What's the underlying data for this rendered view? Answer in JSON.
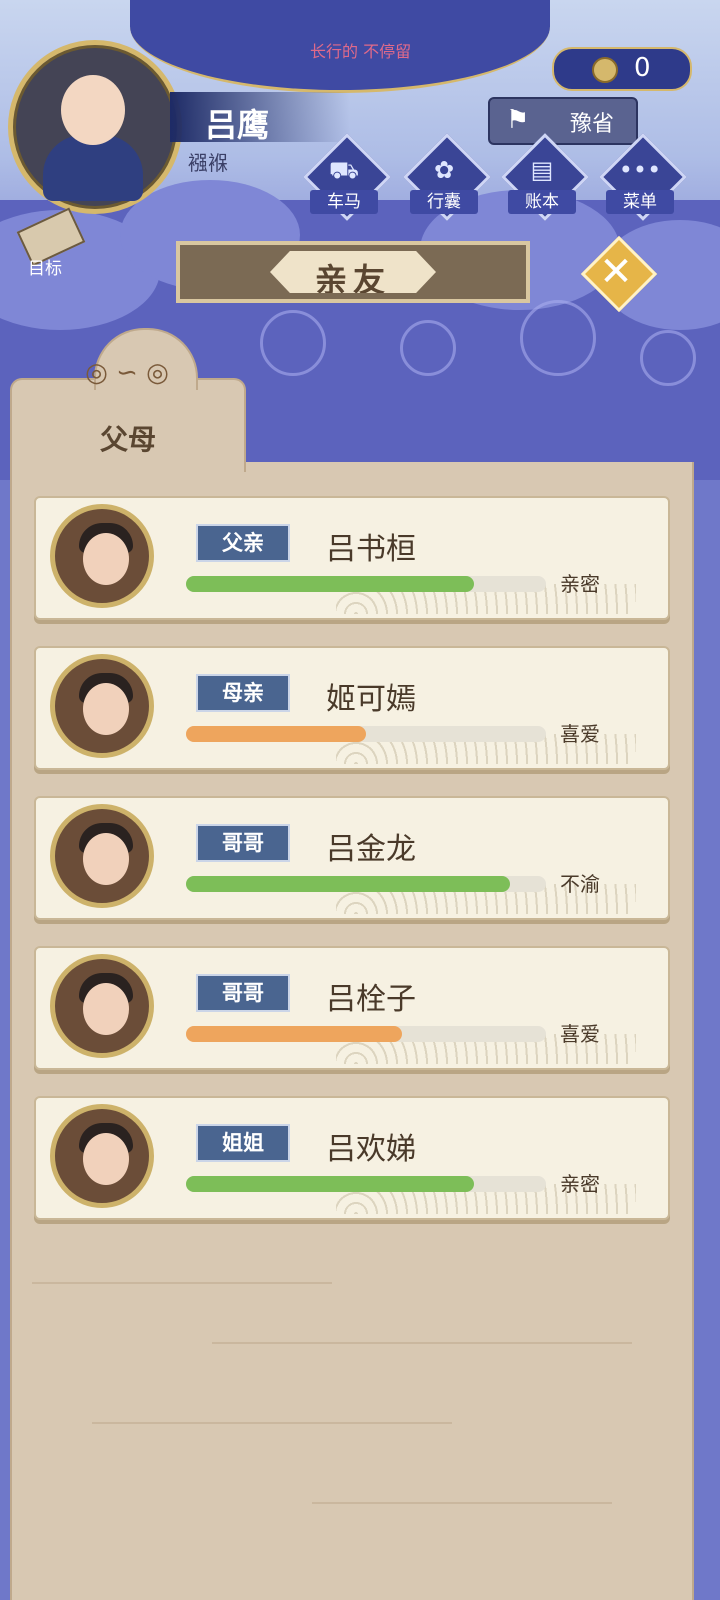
{
  "header": {
    "marquee": "长行的 不停留",
    "player": {
      "name": "吕鹰",
      "age_label": "襁褓"
    },
    "coins": "0",
    "location": "豫省"
  },
  "nav": [
    {
      "key": "carriage",
      "label": "车马",
      "icon": "carriage-icon",
      "glyph": "⛟"
    },
    {
      "key": "bag",
      "label": "行囊",
      "icon": "bag-icon",
      "glyph": "✿"
    },
    {
      "key": "ledger",
      "label": "账本",
      "icon": "ledger-icon",
      "glyph": "▤"
    },
    {
      "key": "menu",
      "label": "菜单",
      "icon": "more-icon",
      "glyph": "•••"
    }
  ],
  "goal": {
    "label": "目标"
  },
  "title": "亲友",
  "tab": {
    "label": "父母"
  },
  "colors": {
    "green_bar": "#7dbe58",
    "orange_bar": "#eea55d",
    "badge": "#4a6590"
  },
  "relatives": [
    {
      "relation": "父亲",
      "name": "吕书桓",
      "affinity_label": "亲密",
      "affinity_fraction": 0.8,
      "bar_color": "green"
    },
    {
      "relation": "母亲",
      "name": "姬可嫣",
      "affinity_label": "喜爱",
      "affinity_fraction": 0.5,
      "bar_color": "orange"
    },
    {
      "relation": "哥哥",
      "name": "吕金龙",
      "affinity_label": "不渝",
      "affinity_fraction": 0.9,
      "bar_color": "green"
    },
    {
      "relation": "哥哥",
      "name": "吕栓子",
      "affinity_label": "喜爱",
      "affinity_fraction": 0.6,
      "bar_color": "orange"
    },
    {
      "relation": "姐姐",
      "name": "吕欢娣",
      "affinity_label": "亲密",
      "affinity_fraction": 0.8,
      "bar_color": "green"
    }
  ]
}
